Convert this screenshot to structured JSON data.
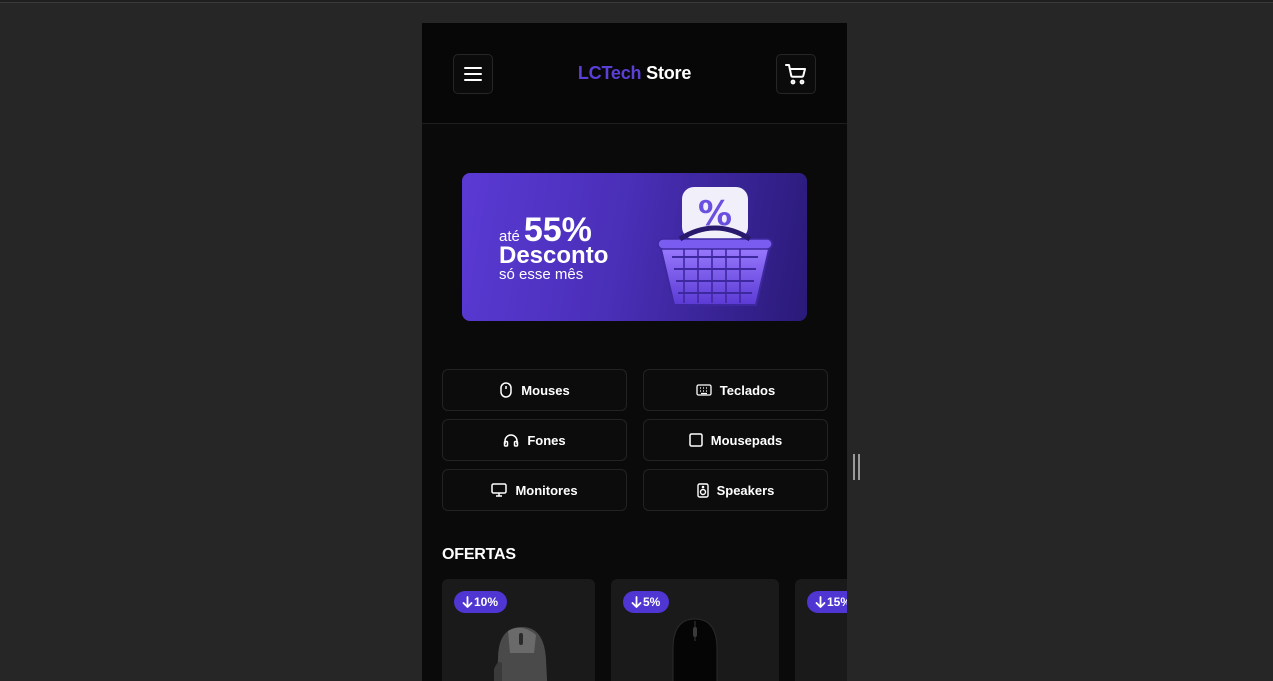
{
  "header": {
    "brand_part1": "LCTech",
    "brand_part2": "Store",
    "menu_icon": "hamburger-menu-icon",
    "cart_icon": "shopping-cart-icon"
  },
  "banner": {
    "ate": "até",
    "percent": "55%",
    "desconto": "Desconto",
    "mes": "só esse mês",
    "colors": {
      "start": "#5a3ad4",
      "end": "#2a1a78"
    }
  },
  "categories": [
    {
      "label": "Mouses",
      "icon": "mouse-icon"
    },
    {
      "label": "Teclados",
      "icon": "keyboard-icon"
    },
    {
      "label": "Fones",
      "icon": "headphones-icon"
    },
    {
      "label": "Mousepads",
      "icon": "square-icon"
    },
    {
      "label": "Monitores",
      "icon": "monitor-icon"
    },
    {
      "label": "Speakers",
      "icon": "speaker-icon"
    }
  ],
  "offers": {
    "title": "OFERTAS",
    "cards": [
      {
        "discount": "10%"
      },
      {
        "discount": "5%"
      },
      {
        "discount": "15%"
      }
    ]
  },
  "colors": {
    "accent": "#5b3fd6",
    "badge": "#4f35d1",
    "background": "#0a0a0a"
  }
}
